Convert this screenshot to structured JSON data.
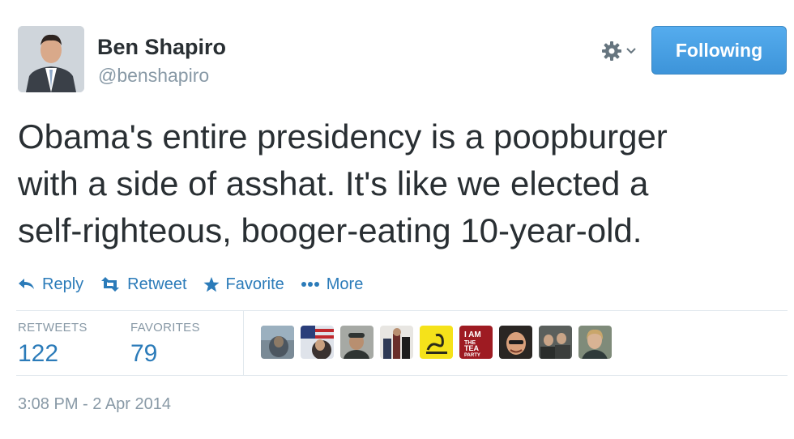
{
  "tweet": {
    "author": {
      "name": "Ben Shapiro",
      "handle": "@benshapiro",
      "avatar_icon": "profile-photo"
    },
    "follow_button_label": "Following",
    "menu_icon": "gear-icon",
    "text": "Obama's entire presidency is a poopburger\nwith a side of asshat. It's like we elected a\nself-righteous, booger-eating 10-year-old.",
    "actions": {
      "reply": "Reply",
      "retweet": "Retweet",
      "favorite": "Favorite",
      "more": "More"
    },
    "stats": {
      "retweets_label": "RETWEETS",
      "retweets_count": "122",
      "favorites_label": "FAVORITES",
      "favorites_count": "79"
    },
    "favoriting_users": [
      {
        "icon": "user-avatar-1"
      },
      {
        "icon": "user-avatar-2"
      },
      {
        "icon": "user-avatar-3"
      },
      {
        "icon": "user-avatar-4"
      },
      {
        "icon": "gadsden-flag-avatar"
      },
      {
        "icon": "tea-party-avatar",
        "text": "I AM THE TEA PARTY"
      },
      {
        "icon": "user-avatar-7"
      },
      {
        "icon": "user-avatar-8"
      },
      {
        "icon": "user-avatar-9"
      }
    ],
    "timestamp": "3:08 PM - 2 Apr 2014",
    "colors": {
      "link_blue": "#2b7bb9",
      "follow_blue": "#55acee",
      "muted_gray": "#8899a6",
      "text_dark": "#292f33"
    }
  }
}
